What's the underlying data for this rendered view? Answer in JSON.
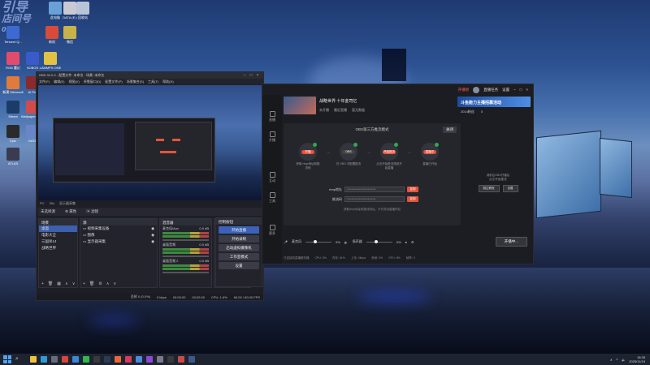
{
  "desktop": {
    "watermark": [
      "引导",
      "店间号",
      "0224"
    ],
    "icons": [
      {
        "label": "此电脑",
        "color": "#6aa0d8"
      },
      {
        "label": "DATA (E:)",
        "color": "#c9c9d1"
      },
      {
        "label": "回收站",
        "color": "#b8c4d8"
      },
      {
        "label": "Tencent Q...",
        "color": "#3d6ad1"
      },
      {
        "label": "新机",
        "color": "#d84b3b"
      },
      {
        "label": "微信",
        "color": "#c8b24a"
      },
      {
        "label": "RGB 魔幻",
        "color": "#e24c6c"
      },
      {
        "label": "SOBOS",
        "color": "#3b5ac9"
      },
      {
        "label": "LAMMPS ONE",
        "color": "#e2c243"
      },
      {
        "label": "新建 Microsoft",
        "color": "#e07b3c"
      },
      {
        "label": "AI Pro",
        "color": "#8a2a2a"
      },
      {
        "label": "Microsoft Excel",
        "color": "#3bb84f"
      },
      {
        "label": "Steam",
        "color": "#1b3c68"
      },
      {
        "label": "Wallpaper Engine",
        "color": "#d24b4b"
      },
      {
        "label": "Epic",
        "color": "#2a2a2a"
      },
      {
        "label": "DATA",
        "color": "#6a86c8"
      },
      {
        "label": "ATLAS",
        "color": "#3a3a50"
      }
    ]
  },
  "obs": {
    "title": "OBS 32.0.2 - 配置文件: 未命名 - 场景: 未命名",
    "menu": [
      "文件(F)",
      "编辑(E)",
      "视图(V)",
      "停靠窗口(D)",
      "配置文件(P)",
      "场景集合(S)",
      "工具(T)",
      "帮助(H)"
    ],
    "preview_status": [
      "PC",
      "30s",
      "显示器采集"
    ],
    "scene_bar": [
      "未选择源",
      "属性",
      "滤镜"
    ],
    "scenes": {
      "title": "场景",
      "items": [
        "桌面",
        "电影大全",
        "三国杀14",
        "战略世界"
      ]
    },
    "sources": {
      "title": "源",
      "items": [
        "视频采集设备",
        "图像",
        "显示器采集"
      ]
    },
    "mixer": {
      "title": "混音器",
      "channels": [
        {
          "name": "麦克风/Aux",
          "db": "0.0 dB"
        },
        {
          "name": "桌面音频",
          "db": "0.0 dB"
        },
        {
          "name": "桌面音频 2",
          "db": "0.0 dB"
        }
      ]
    },
    "transitions": {
      "title": "转场动画",
      "type": "淡入淡出",
      "duration_label": "时长",
      "duration": "300 ms"
    },
    "controls": {
      "title": "控制按钮",
      "buttons": [
        "开始直播",
        "开始录制",
        "启动虚拟摄像机",
        "工作室模式",
        "设置"
      ]
    },
    "footer": [
      "丢帧 0 (0.0%)",
      "0 kbps",
      "00:00:00",
      "00:00:00",
      "CPU: 1.6%",
      "60.00 / 60.00 FPS"
    ]
  },
  "live": {
    "topbar": {
      "hot": "开播榜",
      "items": [
        "直播任务",
        "设置"
      ]
    },
    "stream": {
      "title": "战略世界 十年金司忆",
      "status": [
        "未开播",
        "最近直播",
        "暂无数据"
      ]
    },
    "banner": "斗鱼能力主播招募活动",
    "stats": [
      "2014粉丝",
      "0"
    ],
    "nav": [
      "直播",
      "开播",
      "互动",
      "工具",
      "更多"
    ],
    "setup": {
      "title": "OBS第三方推流模式",
      "close": "关闭",
      "steps": [
        {
          "pill": "开播",
          "desc": "获取 rtmp地址和推流码"
        },
        {
          "pill": "OBS",
          "desc": "在 OBS 中配置推流"
        },
        {
          "pill": "开始推流",
          "desc": "点击开始推流按钮开始直播"
        },
        {
          "pill": "直播中",
          "desc": "直播已开始"
        }
      ],
      "fields": [
        {
          "label": "rtmp地址",
          "value": "**************************",
          "copy": "复制"
        },
        {
          "label": "推流码",
          "value": "**************************",
          "copy": "复制"
        }
      ],
      "note": "获取rtmp地址和推流码后，不可关闭直播伴侣"
    },
    "controls": {
      "mic": "麦克风",
      "speaker": "扬声器",
      "mic_val": "0%",
      "spk_val": "0%",
      "go_live": "开播中..."
    },
    "status": [
      "已连接到直播服务器",
      "CPU: 5%",
      "内存: 61%",
      "上传: 0kbps",
      "丢帧: 0%",
      "GPU: 8%",
      "帧率: 0"
    ],
    "side": {
      "text": [
        "请前往OBS开播后",
        "点击'开始推流'"
      ],
      "buttons": [
        "跳过教程",
        "设置"
      ]
    }
  },
  "taskbar": {
    "apps": [
      {
        "name": "file-explorer-icon",
        "color": "#f0c23c"
      },
      {
        "name": "edge-icon",
        "color": "#2e9ad8"
      },
      {
        "name": "store-icon",
        "color": "#6a6a7a"
      },
      {
        "name": "chrome-icon",
        "color": "#d8453a"
      },
      {
        "name": "qq-icon",
        "color": "#3a86d8"
      },
      {
        "name": "wechat-icon",
        "color": "#2fb84f"
      },
      {
        "name": "obs-icon",
        "color": "#3a3a3a"
      },
      {
        "name": "steam-icon",
        "color": "#2a3b5a"
      },
      {
        "name": "douyu-icon",
        "color": "#e8683a"
      },
      {
        "name": "music-icon",
        "color": "#d83a5a"
      },
      {
        "name": "wallpaper-icon",
        "color": "#4a8ad8"
      },
      {
        "name": "game-icon",
        "color": "#8a4ad8"
      },
      {
        "name": "settings-icon",
        "color": "#7a7a8a"
      },
      {
        "name": "epic-icon",
        "color": "#3a3a3a"
      },
      {
        "name": "app-icon",
        "color": "#c84a4a"
      },
      {
        "name": "steam2-icon",
        "color": "#3a5a8a"
      }
    ],
    "time": "18:28",
    "date": "2025/11/19"
  }
}
